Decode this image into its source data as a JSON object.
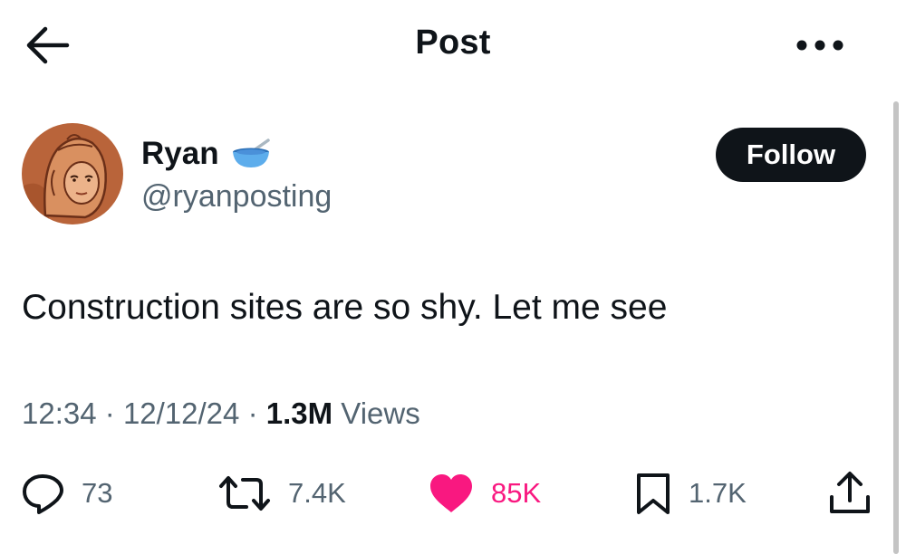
{
  "header": {
    "title": "Post"
  },
  "author": {
    "name": "Ryan",
    "handle": "@ryanposting"
  },
  "follow_label": "Follow",
  "tweet": {
    "text": "Construction sites are so shy. Let me see"
  },
  "meta": {
    "time": "12:34",
    "separator": "·",
    "date": "12/12/24",
    "views_count": "1.3M",
    "views_label": "Views"
  },
  "actions": {
    "replies": "73",
    "reposts": "7.4K",
    "likes": "85K",
    "bookmarks": "1.7K"
  },
  "icons": [
    "back-arrow-icon",
    "more-icon",
    "bowl-spoon-emoji-icon",
    "reply-icon",
    "repost-icon",
    "heart-icon",
    "bookmark-icon",
    "share-icon"
  ],
  "colors": {
    "text": "#0f1419",
    "secondary": "#536471",
    "like": "#f91880",
    "follow_bg": "#0f1419"
  }
}
